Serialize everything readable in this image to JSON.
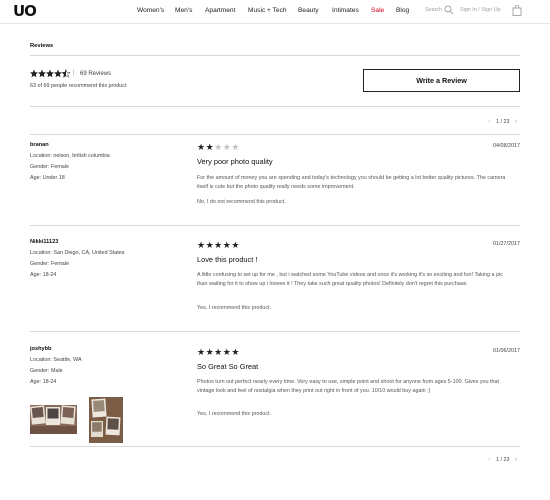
{
  "header": {
    "logo": "UO",
    "nav": [
      {
        "label": "Women's",
        "id": "womens"
      },
      {
        "label": "Men's",
        "id": "mens"
      },
      {
        "label": "Apartment",
        "id": "apartment"
      },
      {
        "label": "Music + Tech",
        "id": "music-tech"
      },
      {
        "label": "Beauty",
        "id": "beauty"
      },
      {
        "label": "Intimates",
        "id": "intimates"
      },
      {
        "label": "Sale",
        "id": "sale"
      },
      {
        "label": "Blog",
        "id": "blog"
      }
    ],
    "search_label": "Search",
    "signin_label": "Sign In / Sign Up",
    "colors": {
      "sale": "#d0021b",
      "muted": "#a0a0a0"
    }
  },
  "reviews_section": {
    "title": "Reviews",
    "summary": {
      "rating": 4.5,
      "review_count_label": "69 Reviews",
      "recommend_label": "63 of 69 people recommend this product"
    },
    "write_review_label": "Write a Review",
    "pagination_top": "1 / 23",
    "pagination_bottom": "1 / 23"
  },
  "reviews": [
    {
      "user": "branan",
      "location": "Location: nelson, british columbia",
      "gender": "Gender: Female",
      "age": "Age: Under 18",
      "rating": 2,
      "date": "04/08/2017",
      "title": "Very poor photo quality",
      "body": "For the amount of money you are spending and today's technology you should be getting a lot better quality pictures. The camera itself is cute but the photo quality really needs some improvement.",
      "recommend": "No, I do not recommend this product."
    },
    {
      "user": "Nikki11123",
      "location": "Location: San Diego, CA, United States",
      "gender": "Gender: Female",
      "age": "Age: 18-24",
      "rating": 5,
      "date": "01/27/2017",
      "title": "Love this product !",
      "body": "A little confusing to set up for me , but i watched some YouTube videos and once it's working it's so exciting and fun! Taking a pic than waiting for it to show up i loveee it ! They take such great quality photos! Definitely don't regret this purchase.",
      "recommend": "Yes, I recommend this product."
    },
    {
      "user": "joshybb",
      "location": "Location: Seattle, WA",
      "gender": "Gender: Male",
      "age": "Age: 18-24",
      "rating": 5,
      "date": "01/06/2017",
      "title": "So Great So Great",
      "body": "Photos turn out perfect nearly every time. Very easy to use, simple point and shoot for anyone from ages 5-100. Gives you that vintage look and feel of nostalgia when they print out right in front of you. 10/10 would buy again ;)",
      "recommend": "Yes, I recommend this product."
    }
  ]
}
